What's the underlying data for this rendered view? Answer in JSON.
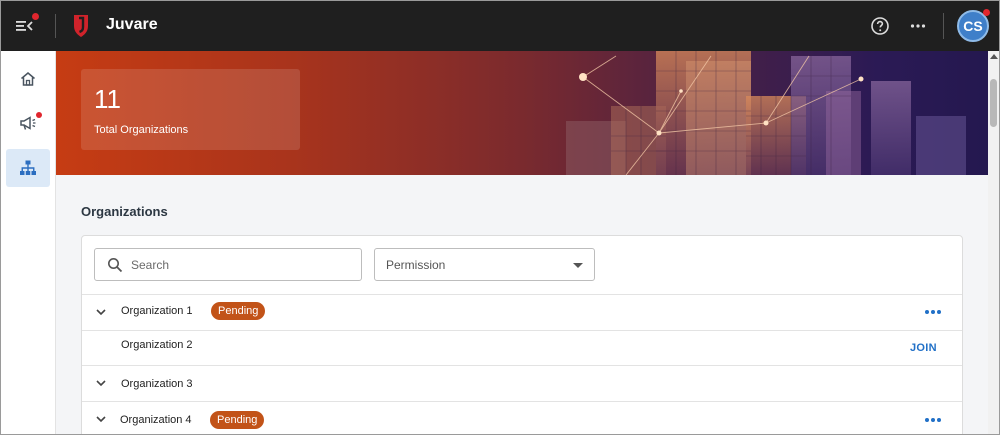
{
  "topbar": {
    "brand": "Juvare",
    "avatar_initials": "CS",
    "icons": [
      "menu-collapse-icon",
      "juvare-logo",
      "help-icon",
      "more-icon"
    ],
    "notification_color": "#e0262e"
  },
  "sidebar": {
    "items": [
      {
        "icon": "home-icon",
        "active": false,
        "notification": false
      },
      {
        "icon": "megaphone-icon",
        "active": false,
        "notification": true
      },
      {
        "icon": "org-hierarchy-icon",
        "active": true,
        "notification": false
      }
    ]
  },
  "hero": {
    "stat_value": "11",
    "stat_label": "Total Organizations"
  },
  "organizations": {
    "title": "Organizations",
    "search_placeholder": "Search",
    "permission_label": "Permission",
    "rows": [
      {
        "name": "Organization 1",
        "status": "Pending",
        "expandable": true,
        "action": "more"
      },
      {
        "name": "Organization 2",
        "status": "",
        "expandable": false,
        "action": "JOIN"
      },
      {
        "name": "Organization 3",
        "status": "",
        "expandable": true,
        "action": ""
      },
      {
        "name": "Organization 4",
        "status": "Pending",
        "expandable": true,
        "action": "more"
      }
    ]
  },
  "colors": {
    "accent": "#2170c7",
    "pending_badge": "#c25318",
    "topbar": "#1f1f1f"
  }
}
